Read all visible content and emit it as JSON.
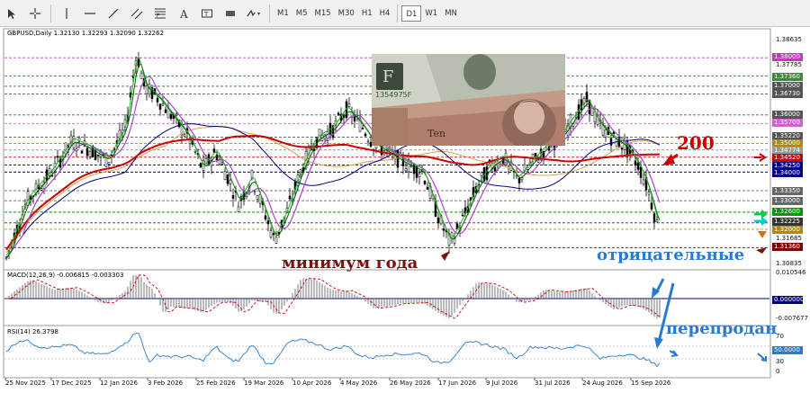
{
  "toolbar": {
    "timeframes": [
      "M1",
      "M5",
      "M15",
      "M30",
      "H1",
      "H4",
      "D1",
      "W1",
      "MN"
    ],
    "active_timeframe": "D1"
  },
  "chart": {
    "header": "GBPUSD,Daily  1.32130 1.32293 1.32090 1.32262",
    "macd_header": "MACD(12,26,9) -0.006815 -0.003303",
    "rsi_header": "RSI(14) 26.3798"
  },
  "price_axis": {
    "ticks": [
      "1.38635",
      "1.37785",
      "1.31685",
      "1.30835"
    ],
    "tags": [
      {
        "text": "1.38000",
        "bg": "#cc33cc"
      },
      {
        "text": "1.37360",
        "bg": "#3a8a3a"
      },
      {
        "text": "1.37000",
        "bg": "#555555"
      },
      {
        "text": "1.36730",
        "bg": "#555555"
      },
      {
        "text": "1.36000",
        "bg": "#555555"
      },
      {
        "text": "1.35700",
        "bg": "#cc66cc"
      },
      {
        "text": "1.35220",
        "bg": "#555555"
      },
      {
        "text": "1.35000",
        "bg": "#b8860b"
      },
      {
        "text": "1.34774",
        "bg": "#999999"
      },
      {
        "text": "1.34520",
        "bg": "#cc0000"
      },
      {
        "text": "1.34250",
        "bg": "#000080"
      },
      {
        "text": "1.34000",
        "bg": "#000080"
      },
      {
        "text": "1.33350",
        "bg": "#666666"
      },
      {
        "text": "1.33000",
        "bg": "#666666"
      },
      {
        "text": "1.32600",
        "bg": "#009900"
      },
      {
        "text": "1.32225",
        "bg": "#333333"
      },
      {
        "text": "1.32000",
        "bg": "#b8860b"
      },
      {
        "text": "1.31360",
        "bg": "#7a0000"
      }
    ]
  },
  "macd_axis": {
    "ticks": [
      "0.010546",
      "0.000000",
      "-0.007677"
    ]
  },
  "rsi_axis": {
    "ticks": [
      "70",
      "50.0000",
      "30",
      "0"
    ]
  },
  "time_axis": {
    "labels": [
      "25 Nov 2025",
      "17 Dec 2025",
      "12 Jan 2026",
      "3 Feb 2026",
      "25 Feb 2026",
      "19 Mar 2026",
      "10 Apr 2026",
      "4 May 2026",
      "26 May 2026",
      "17 Jun 2026",
      "9 Jul 2026",
      "31 Jul 2026",
      "24 Aug 2026",
      "15 Sep 2026"
    ]
  },
  "annotations": {
    "ma_label": "200",
    "year_low": "минимум года",
    "negative": "отрицательные",
    "oversold": "перепродан"
  },
  "colors": {
    "ma200": "#cc0000",
    "ma_green_fast": "#33aa33",
    "ma_green_slow": "#006600",
    "ma_purple": "#aa44cc",
    "ma_orange": "#d8a050",
    "ma_navy": "#000080",
    "year_low_text": "#7a1010",
    "blue_text": "#2a7ad0"
  }
}
